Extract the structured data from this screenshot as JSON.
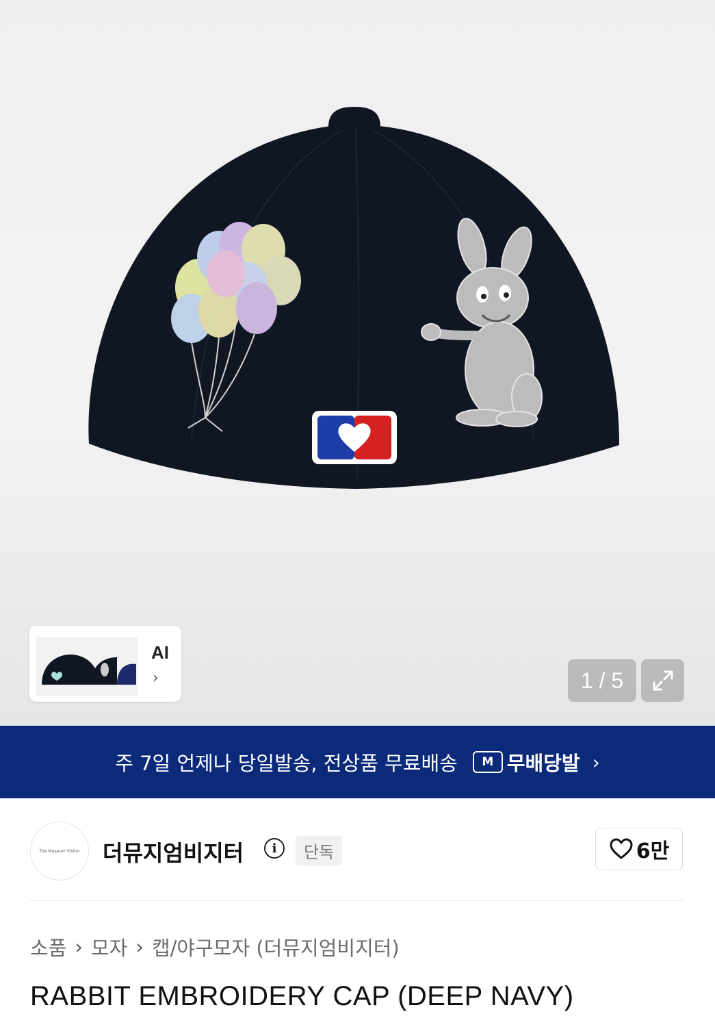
{
  "gallery": {
    "ai_label": "AI",
    "counter": "1 / 5"
  },
  "banner": {
    "text": "주 7일 언제나 당일발송, 전상품 무료배송",
    "brand_badge": "M",
    "brand": "무배당발"
  },
  "seller": {
    "logo_text": "The Museum Visitor",
    "name": "더뮤지엄비지터",
    "badge": "단독",
    "likes": "6만"
  },
  "breadcrumb": {
    "items": [
      "소품",
      "모자",
      "캡/야구모자 (더뮤지엄비지터)"
    ]
  },
  "product": {
    "title": "RABBIT EMBROIDERY CAP (DEEP NAVY)"
  },
  "colors": {
    "banner_bg": "#0b2a7a",
    "cap": "#101622"
  }
}
